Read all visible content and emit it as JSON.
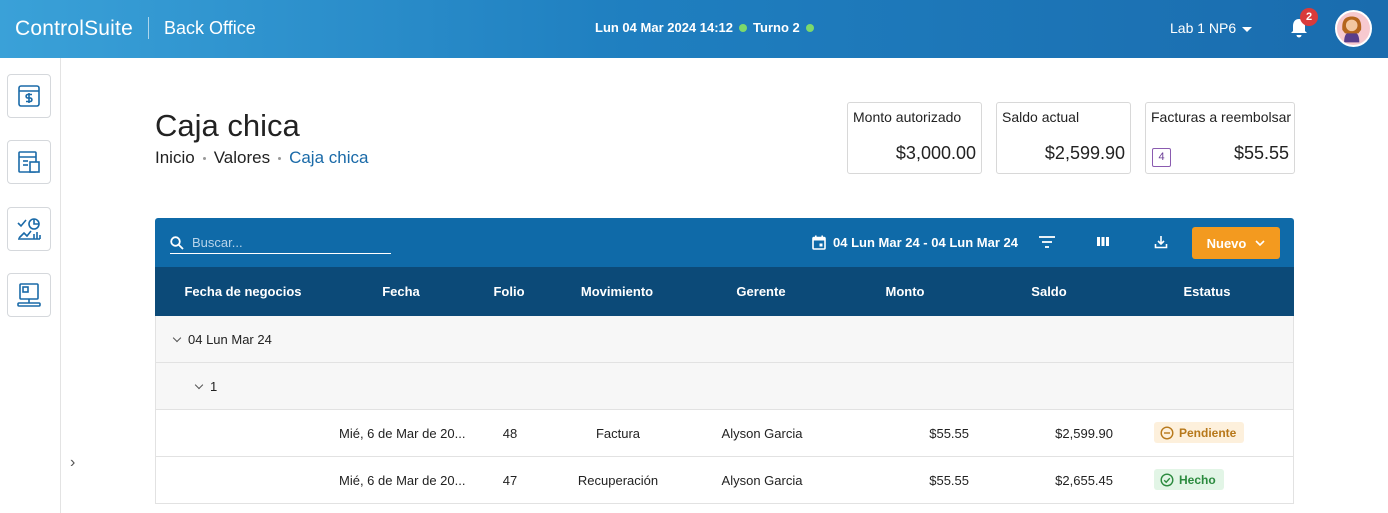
{
  "app": {
    "brand": "ControlSuite",
    "module": "Back Office",
    "datetime": "Lun 04 Mar 2024 14:12",
    "shift": "Turno 2",
    "location": "Lab 1 NP6",
    "notification_count": "2"
  },
  "sidebar": {
    "items": [
      {
        "icon": "cash-register-icon"
      },
      {
        "icon": "documents-icon"
      },
      {
        "icon": "reports-chart-icon"
      },
      {
        "icon": "terminal-icon"
      }
    ],
    "expand": "›"
  },
  "page": {
    "title": "Caja chica",
    "breadcrumb": [
      "Inicio",
      "Valores",
      "Caja chica"
    ]
  },
  "cards": [
    {
      "label": "Monto autorizado",
      "value": "$3,000.00"
    },
    {
      "label": "Saldo actual",
      "value": "$2,599.90"
    },
    {
      "label": "Facturas a reembolsar",
      "value": "$55.55",
      "count": "4"
    }
  ],
  "toolbar": {
    "search_placeholder": "Buscar...",
    "date_range": "04 Lun Mar 24 - 04 Lun Mar 24",
    "new_label": "Nuevo"
  },
  "table": {
    "columns": [
      "Fecha de negocios",
      "Fecha",
      "Folio",
      "Movimiento",
      "Gerente",
      "Monto",
      "Saldo",
      "Estatus"
    ],
    "group_level1": "04 Lun Mar 24",
    "group_level2": "1",
    "rows": [
      {
        "fecha": "Mié, 6 de Mar de 20...",
        "folio": "48",
        "movimiento": "Factura",
        "gerente": "Alyson Garcia",
        "monto": "$55.55",
        "saldo": "$2,599.90",
        "estatus": "Pendiente"
      },
      {
        "fecha": "Mié, 6 de Mar de 20...",
        "folio": "47",
        "movimiento": "Recuperación",
        "gerente": "Alyson Garcia",
        "monto": "$55.55",
        "saldo": "$2,655.45",
        "estatus": "Hecho"
      }
    ]
  },
  "colors": {
    "accent": "#0f6aa8",
    "header_dark": "#0c4a78",
    "primary_action": "#f39a1f",
    "status_pending": "#b7781a",
    "status_done": "#2b8a3e"
  }
}
